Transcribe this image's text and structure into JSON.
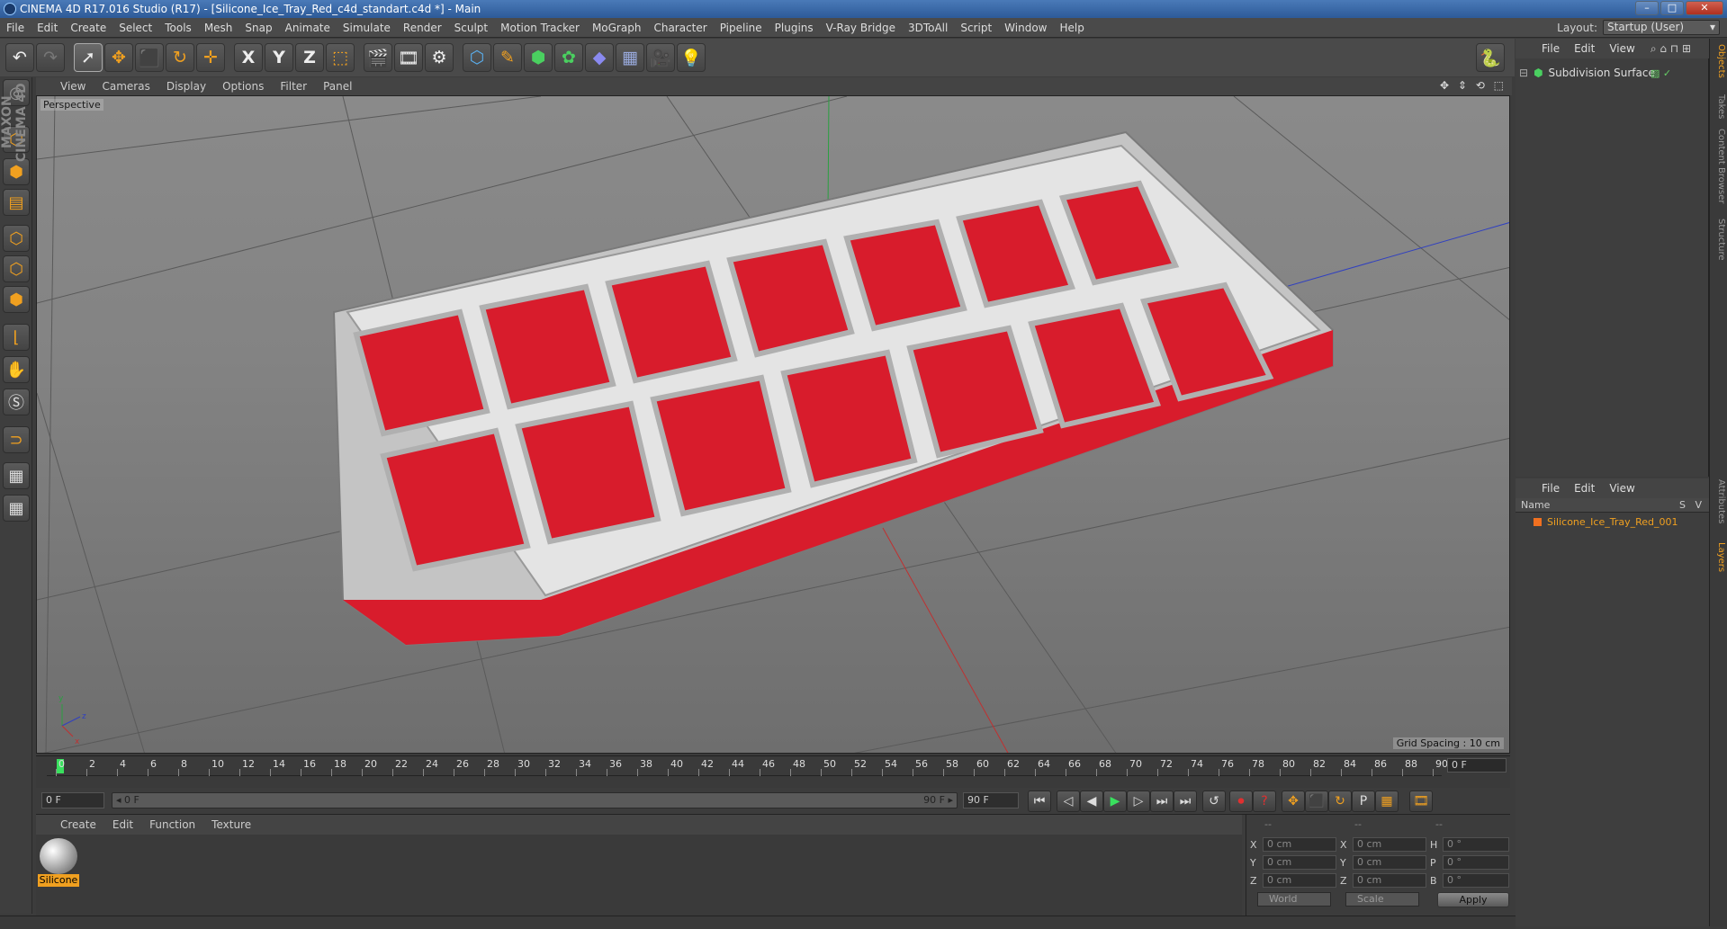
{
  "window": {
    "title": "CINEMA 4D R17.016 Studio (R17) - [Silicone_Ice_Tray_Red_c4d_standart.c4d *] - Main",
    "minimize": "–",
    "maximize": "□",
    "close": "✕"
  },
  "menubar": {
    "items": [
      "File",
      "Edit",
      "Create",
      "Select",
      "Tools",
      "Mesh",
      "Snap",
      "Animate",
      "Simulate",
      "Render",
      "Sculpt",
      "Motion Tracker",
      "MoGraph",
      "Character",
      "Pipeline",
      "Plugins",
      "V-Ray Bridge",
      "3DToAll",
      "Script",
      "Window",
      "Help"
    ],
    "layout_label": "Layout:",
    "layout_value": "Startup (User)"
  },
  "toolbar": {
    "icons": [
      "undo-icon",
      "redo-icon",
      "select-arrow-icon",
      "move-icon",
      "scale-icon",
      "rotate-icon",
      "live-select-icon",
      "x-axis-icon",
      "y-axis-icon",
      "z-axis-icon",
      "coordinate-system-icon",
      "render-view-icon",
      "render-picture-viewer-icon",
      "edit-render-settings-icon",
      "cube-icon",
      "pen-spline-icon",
      "subdivision-icon",
      "array-icon",
      "deformer-icon",
      "floor-icon",
      "camera-icon",
      "light-icon",
      "python-icon"
    ],
    "glyphs": [
      "↶",
      "↷",
      "➚",
      "✥",
      "⬛",
      "↻",
      "✛",
      "X",
      "Y",
      "Z",
      "⬚",
      "🎬",
      "🎞",
      "⚙",
      "⬡",
      "✎",
      "⬢",
      "✿",
      "◆",
      "▦",
      "🎥",
      "💡",
      "🐍"
    ]
  },
  "viewport": {
    "menu": [
      "View",
      "Cameras",
      "Display",
      "Options",
      "Filter",
      "Panel"
    ],
    "nav": "✥ ⇕ ⟲ ⬚",
    "label": "Perspective",
    "grid_spacing": "Grid Spacing : 10 cm",
    "axis_x": "x",
    "axis_y": "y",
    "axis_z": "z"
  },
  "timeline": {
    "ticks": [
      "0",
      "2",
      "4",
      "6",
      "8",
      "10",
      "12",
      "14",
      "16",
      "18",
      "20",
      "22",
      "24",
      "26",
      "28",
      "30",
      "32",
      "34",
      "36",
      "38",
      "40",
      "42",
      "44",
      "46",
      "48",
      "50",
      "52",
      "54",
      "56",
      "58",
      "60",
      "62",
      "64",
      "66",
      "68",
      "70",
      "72",
      "74",
      "76",
      "78",
      "80",
      "82",
      "84",
      "86",
      "88",
      "90"
    ],
    "frame_display": "0 F",
    "start_field": "0 F",
    "range_start": "◂ 0 F",
    "range_end": "90 F ▸",
    "end_field": "90 F"
  },
  "transport": {
    "glyphs": [
      "⏮",
      "◁",
      "◀",
      "▶",
      "▷",
      "⏭",
      "⏭",
      "↺",
      "⏺",
      "?",
      "✥",
      "⬛",
      "↻",
      "P",
      "▦",
      "🎞"
    ]
  },
  "materials": {
    "menu": [
      "Create",
      "Edit",
      "Function",
      "Texture"
    ],
    "items": [
      {
        "label": "Silicone"
      }
    ]
  },
  "coordinates": {
    "header": [
      "--",
      "--",
      "--"
    ],
    "rows": [
      {
        "l1": "X",
        "v1": "0 cm",
        "l2": "X",
        "v2": "0 cm",
        "l3": "H",
        "v3": "0 °"
      },
      {
        "l1": "Y",
        "v1": "0 cm",
        "l2": "Y",
        "v2": "0 cm",
        "l3": "P",
        "v3": "0 °"
      },
      {
        "l1": "Z",
        "v1": "0 cm",
        "l2": "Z",
        "v2": "0 cm",
        "l3": "B",
        "v3": "0 °"
      }
    ],
    "space": "World",
    "mode": "Scale",
    "apply": "Apply"
  },
  "objects": {
    "menu": [
      "File",
      "Edit",
      "View"
    ],
    "items": [
      {
        "name": "Subdivision Surface"
      }
    ]
  },
  "layers": {
    "menu": [
      "File",
      "Edit",
      "View"
    ],
    "columns": {
      "name": "Name",
      "s": "S",
      "v": "V"
    },
    "items": [
      {
        "name": "Silicone_Ice_Tray_Red_001"
      }
    ]
  },
  "right_tabs": [
    "Objects",
    "Takes",
    "Content Browser",
    "Structure",
    "Attributes",
    "Layers"
  ],
  "branding": "MAXON CINEMA 4D",
  "colors": {
    "accent": "#f0a020",
    "playhead": "#39e05e",
    "silicone_red": "#d81c2c"
  }
}
